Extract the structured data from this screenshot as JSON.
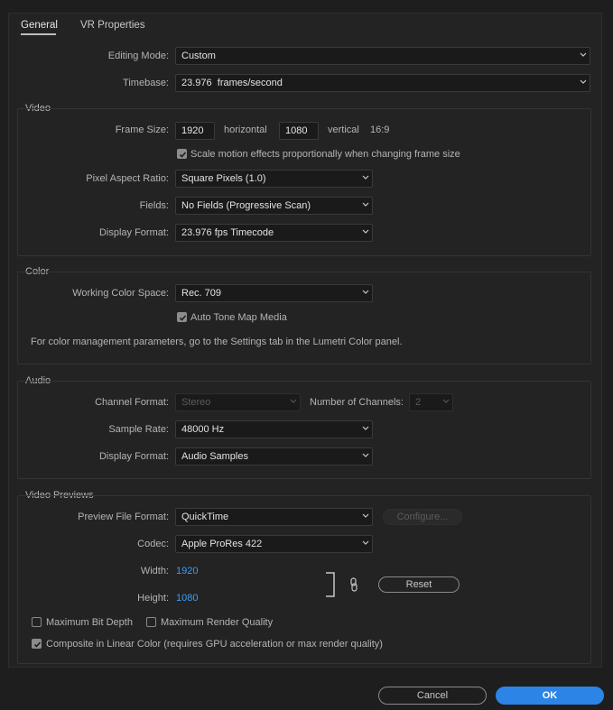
{
  "tabs": [
    {
      "label": "General"
    },
    {
      "label": "VR Properties"
    }
  ],
  "general": {
    "editing_mode_label": "Editing Mode:",
    "editing_mode_value": "Custom",
    "timebase_label": "Timebase:",
    "timebase_value": "23.976  frames/second"
  },
  "video": {
    "title": "Video",
    "frame_size_label": "Frame Size:",
    "width_value": "1920",
    "horizontal_label": "horizontal",
    "height_value": "1080",
    "vertical_label": "vertical",
    "ratio": "16:9",
    "scale_checkbox_label": "Scale motion effects proportionally when changing frame size",
    "pixel_aspect_label": "Pixel Aspect Ratio:",
    "pixel_aspect_value": "Square Pixels (1.0)",
    "fields_label": "Fields:",
    "fields_value": "No Fields (Progressive Scan)",
    "display_format_label": "Display Format:",
    "display_format_value": "23.976 fps Timecode"
  },
  "color": {
    "title": "Color",
    "working_space_label": "Working Color Space:",
    "working_space_value": "Rec. 709",
    "auto_tone_label": "Auto Tone Map Media",
    "note": "For color management parameters, go to the Settings tab in the Lumetri Color panel."
  },
  "audio": {
    "title": "Audio",
    "channel_format_label": "Channel Format:",
    "channel_format_value": "Stereo",
    "num_channels_label": "Number of Channels:",
    "num_channels_value": "2",
    "sample_rate_label": "Sample Rate:",
    "sample_rate_value": "48000 Hz",
    "display_format_label": "Display Format:",
    "display_format_value": "Audio Samples"
  },
  "previews": {
    "title": "Video Previews",
    "file_format_label": "Preview File Format:",
    "file_format_value": "QuickTime",
    "configure_label": "Configure...",
    "codec_label": "Codec:",
    "codec_value": "Apple ProRes 422",
    "width_label": "Width:",
    "width_value": "1920",
    "height_label": "Height:",
    "height_value": "1080",
    "reset_label": "Reset",
    "max_bit_depth_label": "Maximum Bit Depth",
    "max_render_quality_label": "Maximum Render Quality",
    "composite_linear_label": "Composite in Linear Color (requires GPU acceleration or max render quality)"
  },
  "footer": {
    "cancel_label": "Cancel",
    "ok_label": "OK"
  },
  "colors": {
    "accent": "#2c84e6",
    "link": "#3e9cf0",
    "background": "#1e1e1e"
  }
}
